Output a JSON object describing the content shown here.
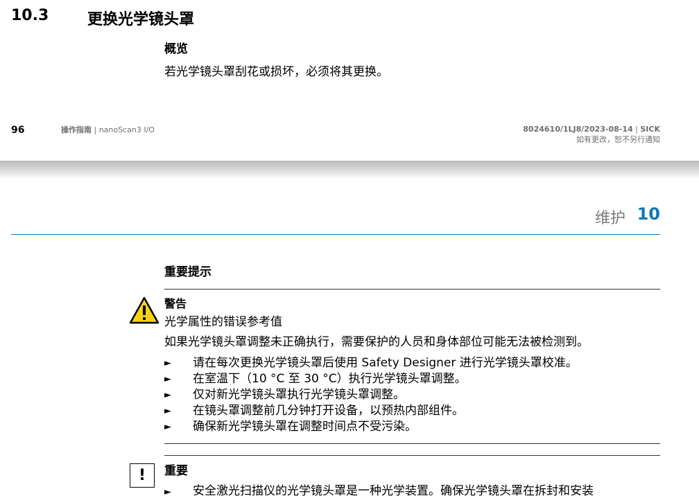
{
  "page1": {
    "section_number": "10.3",
    "section_title": "更换光学镜头罩",
    "overview_heading": "概览",
    "overview_text": "若光学镜头罩刮花或损坏，必须将其更换。",
    "footer": {
      "page_number": "96",
      "doc_type": "操作指南",
      "separator": " | ",
      "product": "nanoScan3 I/O",
      "doc_id": "8024610/1LJ8/2023-08-14",
      "brand": "SICK",
      "notice": "如有更改，恕不另行通知"
    }
  },
  "page2": {
    "chapter_title": "维护",
    "chapter_number": "10",
    "important_notes_heading": "重要提示",
    "warning": {
      "icon": "warning-triangle-icon",
      "title": "警告",
      "subtitle": "光学属性的错误参考值",
      "description": "如果光学镜头罩调整未正确执行，需要保护的人员和身体部位可能无法被检测到。",
      "bullet": "►",
      "steps": [
        "请在每次更换光学镜头罩后使用 Safety Designer 进行光学镜头罩校准。",
        "在室温下（10 °C 至 30 °C）执行光学镜头罩调整。",
        "仅对新光学镜头罩执行光学镜头罩调整。",
        "在镜头罩调整前几分钟打开设备，以预热内部组件。",
        "确保新光学镜头罩在调整时间点不受污染。"
      ]
    },
    "important": {
      "icon": "exclamation-box-icon",
      "icon_symbol": "!",
      "title": "重要",
      "first_item": "安全激光扫描仪的光学镜头罩是一种光学装置。确保光学镜头罩在拆封和安装"
    }
  },
  "colors": {
    "accent_blue": "#0d78b8",
    "warning_yellow": "#f7d117",
    "footer_gray": "#6d6d6d"
  }
}
